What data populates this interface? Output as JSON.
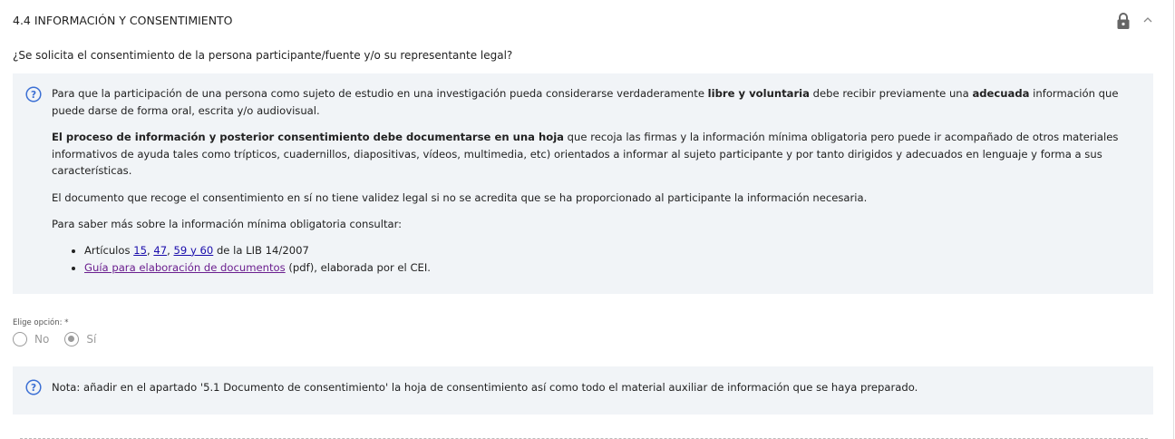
{
  "section": {
    "title": "4.4 INFORMACIÓN Y CONSENTIMIENTO",
    "lock_icon": "lock-icon",
    "collapse_icon": "chevron-up-icon"
  },
  "question": "¿Se solicita el consentimiento de la persona participante/fuente y/o su representante legal?",
  "info": {
    "icon": "help-circle-icon",
    "p1": {
      "a": "Para que la participación de una persona como sujeto de estudio en una investigación pueda considerarse verdaderamente ",
      "b": "libre y voluntaria",
      "c": " debe recibir previamente una ",
      "d": "adecuada",
      "e": " información que puede darse de forma oral, escrita y/o audiovisual."
    },
    "p2": {
      "a": "El proceso de información y posterior consentimiento debe documentarse en una hoja",
      "b": " que recoja las firmas y la información mínima obligatoria pero puede ir acompañado de otros materiales informativos de ayuda tales como trípticos, cuadernillos, diapositivas, vídeos, multimedia, etc) orientados a informar al sujeto participante y por tanto dirigidos y adecuados en lenguaje y forma a sus características."
    },
    "p3": "El documento que recoge el consentimiento en sí no tiene validez legal si no se acredita que se ha proporcionado al participante la información necesaria.",
    "p4": "Para saber más sobre la información mínima obligatoria consultar:",
    "bullet1": {
      "prefix": "Artículos ",
      "link1": "15",
      "sep1": ", ",
      "link2": "47",
      "sep2": ", ",
      "link3": "59 y 60",
      "suffix": " de la LIB 14/2007"
    },
    "bullet2": {
      "link": "Guía para elaboración de documentos",
      "suffix": " (pdf), elaborada por el CEI."
    }
  },
  "choice": {
    "label": "Elige opción: *",
    "options": [
      "No",
      "Sí"
    ],
    "selected": "Sí"
  },
  "note": {
    "icon": "help-circle-icon",
    "text": "Nota: añadir en el apartado '5.1 Documento de consentimiento' la hoja de consentimiento así como todo el material auxiliar de información que se haya preparado."
  },
  "colors": {
    "info_bg": "#f1f4f7",
    "help_icon": "#3b6fd4",
    "link": "#1a0dab",
    "link_visited": "#6b1f8f",
    "radio_disabled": "#9a9a9a"
  }
}
